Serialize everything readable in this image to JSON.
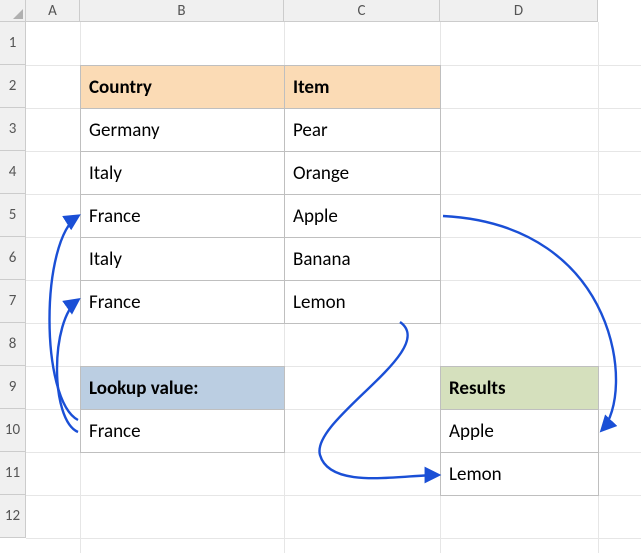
{
  "columns": [
    "A",
    "B",
    "C",
    "D"
  ],
  "rows": [
    "1",
    "2",
    "3",
    "4",
    "5",
    "6",
    "7",
    "8",
    "9",
    "10",
    "11",
    "12"
  ],
  "table": {
    "headers": {
      "country": "Country",
      "item": "Item"
    },
    "rows": [
      {
        "country": "Germany",
        "item": "Pear"
      },
      {
        "country": "Italy",
        "item": "Orange"
      },
      {
        "country": "France",
        "item": "Apple"
      },
      {
        "country": "Italy",
        "item": "Banana"
      },
      {
        "country": "France",
        "item": "Lemon"
      }
    ]
  },
  "lookup": {
    "label": "Lookup value:",
    "value": "France"
  },
  "results": {
    "label": "Results",
    "values": [
      "Apple",
      "Lemon"
    ]
  },
  "arrow_color": "#1a4fd6"
}
